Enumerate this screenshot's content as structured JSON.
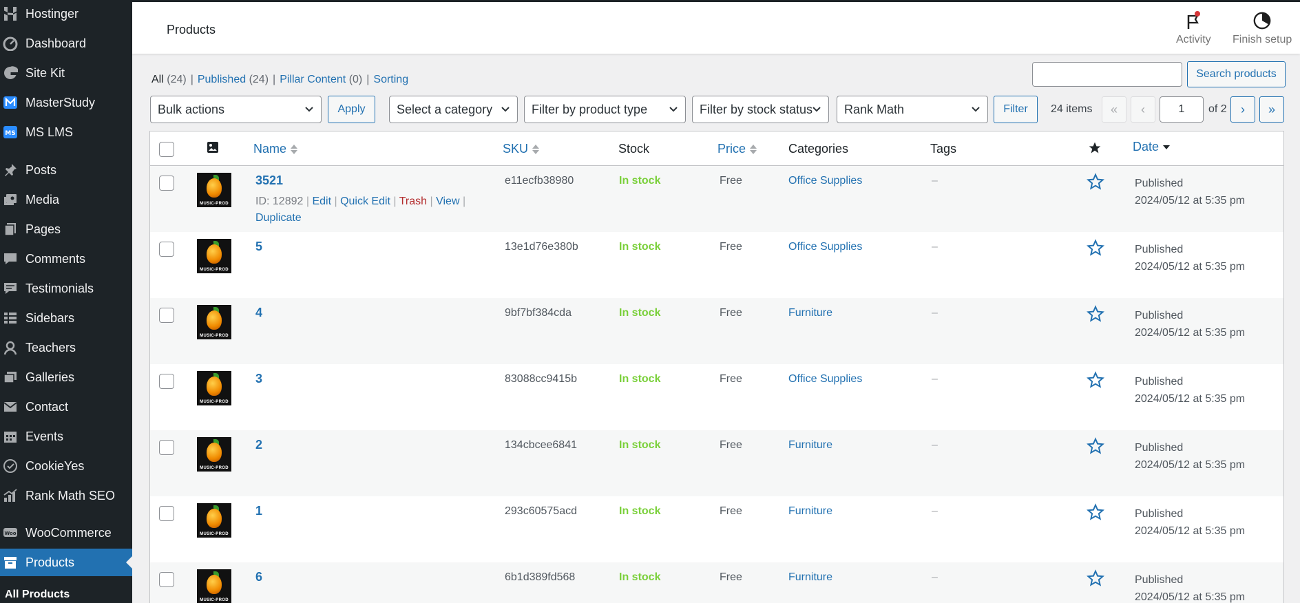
{
  "sidebar": {
    "items": [
      {
        "label": "Hostinger",
        "icon": "hostinger-icon"
      },
      {
        "label": "Dashboard",
        "icon": "dashboard-icon"
      },
      {
        "label": "Site Kit",
        "icon": "site-kit-icon"
      },
      {
        "label": "MasterStudy",
        "icon": "masterstudy-icon"
      },
      {
        "label": "MS LMS",
        "icon": "ms-lms-icon"
      },
      {
        "label": "Posts",
        "icon": "pin-icon"
      },
      {
        "label": "Media",
        "icon": "media-icon"
      },
      {
        "label": "Pages",
        "icon": "pages-icon"
      },
      {
        "label": "Comments",
        "icon": "comments-icon"
      },
      {
        "label": "Testimonials",
        "icon": "testimonials-icon"
      },
      {
        "label": "Sidebars",
        "icon": "sidebars-icon"
      },
      {
        "label": "Teachers",
        "icon": "teachers-icon"
      },
      {
        "label": "Galleries",
        "icon": "galleries-icon"
      },
      {
        "label": "Contact",
        "icon": "mail-icon"
      },
      {
        "label": "Events",
        "icon": "calendar-icon"
      },
      {
        "label": "CookieYes",
        "icon": "cookieyes-icon"
      },
      {
        "label": "Rank Math SEO",
        "icon": "rank-math-icon"
      },
      {
        "label": "WooCommerce",
        "icon": "woocommerce-icon"
      },
      {
        "label": "Products",
        "icon": "archive-icon"
      }
    ],
    "active": "Products",
    "submenu_current": "All Products"
  },
  "header": {
    "title": "Products",
    "activity_label": "Activity",
    "finish_setup_label": "Finish setup",
    "activity_dot_color": "#d63638"
  },
  "views": {
    "all": {
      "label": "All",
      "count": "(24)"
    },
    "published": {
      "label": "Published",
      "count": "(24)"
    },
    "pillar": {
      "label": "Pillar Content",
      "count": "(0)"
    },
    "sorting": "Sorting",
    "separator": "|"
  },
  "search": {
    "value": "",
    "button": "Search products"
  },
  "filters": {
    "bulk_actions": "Bulk actions",
    "apply": "Apply",
    "category": "Select a category",
    "product_type": "Filter by product type",
    "stock_status": "Filter by stock status",
    "rank_math": "Rank Math",
    "filter_button": "Filter"
  },
  "pagination": {
    "items": "24 items",
    "first": "«",
    "prev": "‹",
    "current": "1",
    "of": "of 2",
    "next": "›",
    "last": "»"
  },
  "table": {
    "columns": {
      "name": "Name",
      "sku": "SKU",
      "stock": "Stock",
      "price": "Price",
      "categories": "Categories",
      "tags": "Tags",
      "date": "Date"
    },
    "row_actions": {
      "id": "ID: 12892",
      "edit": "Edit",
      "quick_edit": "Quick Edit",
      "trash": "Trash",
      "view": "View",
      "duplicate": "Duplicate"
    },
    "thumb_text": "MUSIC-PROD",
    "rows": [
      {
        "name": "3521",
        "sku": "e11ecfb38980",
        "stock": "In stock",
        "price": "Free",
        "category": "Office Supplies",
        "tags": "–",
        "status": "Published",
        "date": "2024/05/12 at 5:35 pm"
      },
      {
        "name": "5",
        "sku": "13e1d76e380b",
        "stock": "In stock",
        "price": "Free",
        "category": "Office Supplies",
        "tags": "–",
        "status": "Published",
        "date": "2024/05/12 at 5:35 pm"
      },
      {
        "name": "4",
        "sku": "9bf7bf384cda",
        "stock": "In stock",
        "price": "Free",
        "category": "Furniture",
        "tags": "–",
        "status": "Published",
        "date": "2024/05/12 at 5:35 pm"
      },
      {
        "name": "3",
        "sku": "83088cc9415b",
        "stock": "In stock",
        "price": "Free",
        "category": "Office Supplies",
        "tags": "–",
        "status": "Published",
        "date": "2024/05/12 at 5:35 pm"
      },
      {
        "name": "2",
        "sku": "134cbcee6841",
        "stock": "In stock",
        "price": "Free",
        "category": "Furniture",
        "tags": "–",
        "status": "Published",
        "date": "2024/05/12 at 5:35 pm"
      },
      {
        "name": "1",
        "sku": "293c60575acd",
        "stock": "In stock",
        "price": "Free",
        "category": "Furniture",
        "tags": "–",
        "status": "Published",
        "date": "2024/05/12 at 5:35 pm"
      },
      {
        "name": "6",
        "sku": "6b1d389fd568",
        "stock": "In stock",
        "price": "Free",
        "category": "Furniture",
        "tags": "–",
        "status": "Published",
        "date": "2024/05/12 at 5:35 pm"
      }
    ]
  },
  "colors": {
    "sidebar_bg": "#1d2327",
    "accent": "#2271b1",
    "in_stock": "#7ad03a",
    "trash": "#b32d2e"
  }
}
